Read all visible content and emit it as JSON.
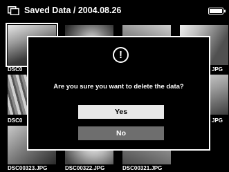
{
  "header": {
    "title": "Saved Data / 2004.08.26",
    "folder_icon": "folder-icon",
    "battery_icon": "battery-icon"
  },
  "thumbnails": {
    "row1_left_label": "DSC0",
    "row1_right_label": "JPG",
    "row2_left_label": "DSC0",
    "row2_right_label": "JPG",
    "row3_labels": [
      "DSC00323.JPG",
      "DSC00322.JPG",
      "DSC00321.JPG"
    ]
  },
  "dialog": {
    "icon": "alert-icon",
    "icon_glyph": "!",
    "message": "Are you sure you want to delete the data?",
    "yes_label": "Yes",
    "no_label": "No"
  },
  "colors": {
    "background": "#000000",
    "text": "#ffffff",
    "selected_button": "#e8e8e8",
    "unselected_button": "#6e6e6e"
  }
}
